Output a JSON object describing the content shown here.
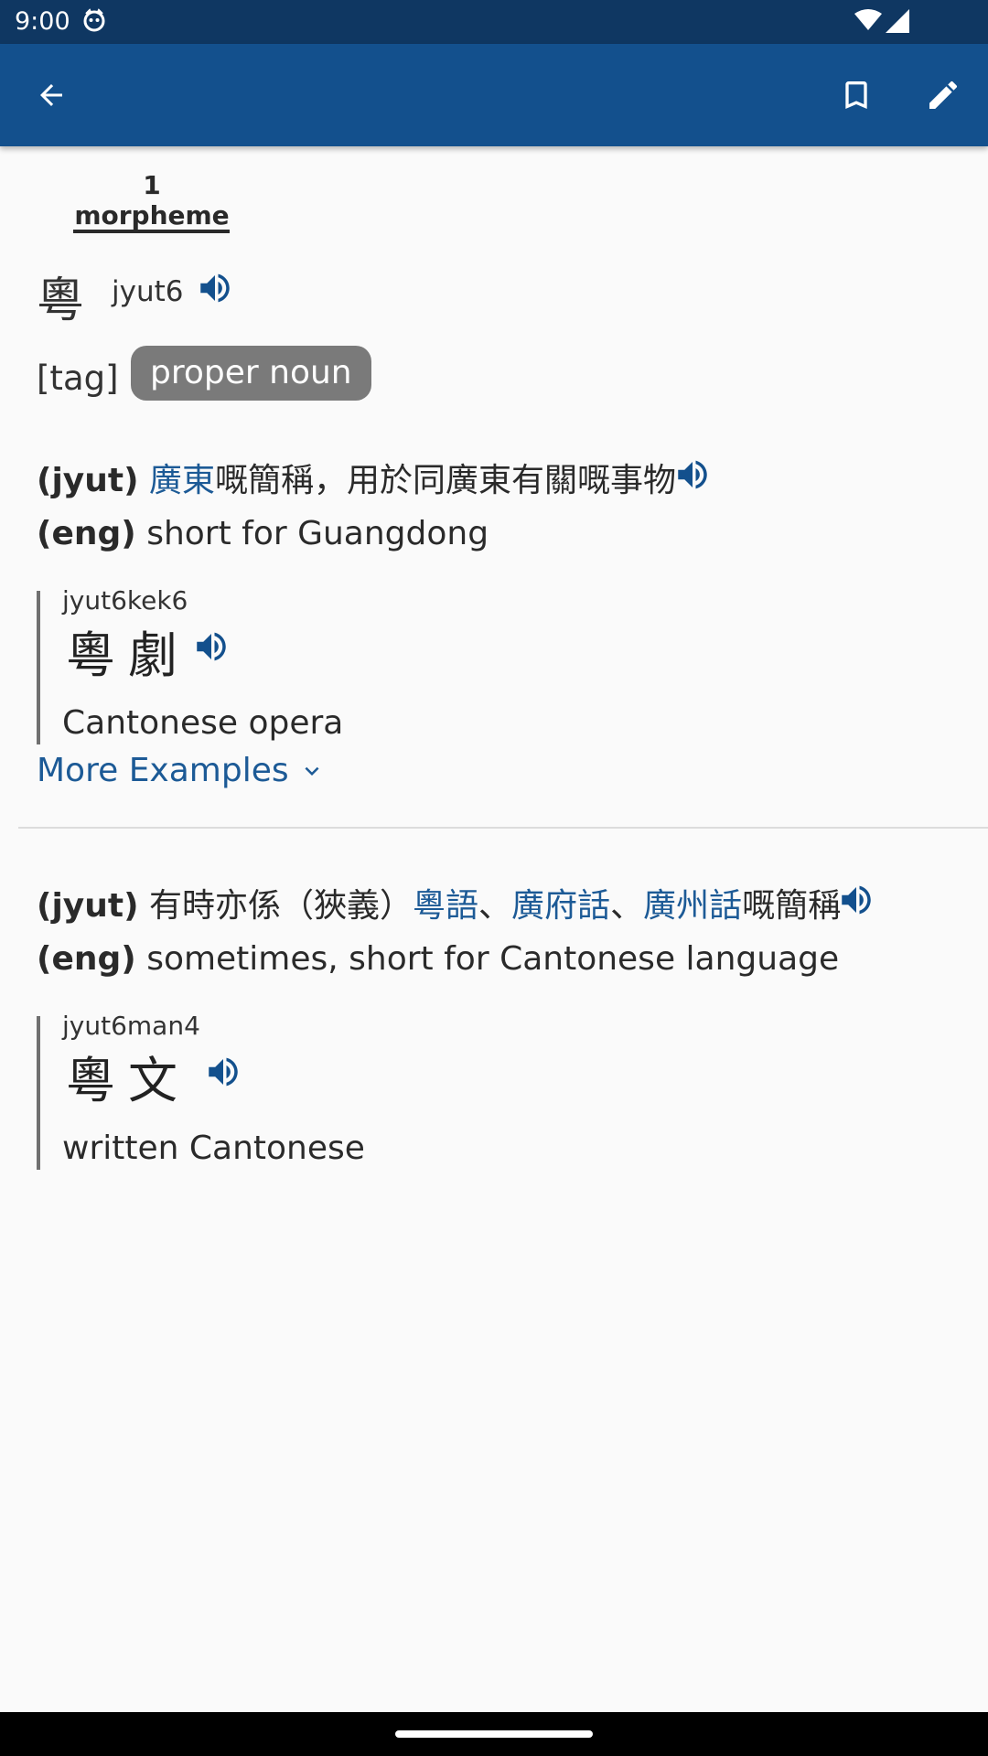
{
  "status_bar": {
    "time": "9:00"
  },
  "tabs": [
    {
      "label": "1 morpheme"
    }
  ],
  "entry": {
    "headword": "粵",
    "jyutping": "jyut6",
    "tag_label": "[tag]",
    "tag_value": "proper noun"
  },
  "definitions": [
    {
      "jyut_label": "(jyut)",
      "jyut_parts": [
        {
          "text": "廣東",
          "link": true
        },
        {
          "text": "嘅簡稱，用於同廣東有關嘅事物",
          "link": false
        }
      ],
      "eng_label": "(eng)",
      "eng_text": "short for Guangdong",
      "examples": [
        {
          "jyutping": "jyut6kek6",
          "word": "粵劇",
          "eng": "Cantonese opera"
        }
      ],
      "more_examples": "More Examples"
    },
    {
      "jyut_label": "(jyut)",
      "jyut_parts": [
        {
          "text": "有時亦係（狹義）",
          "link": false
        },
        {
          "text": "粵語",
          "link": true
        },
        {
          "text": "、",
          "link": false
        },
        {
          "text": "廣府話",
          "link": true
        },
        {
          "text": "、",
          "link": false
        },
        {
          "text": "廣州話",
          "link": true
        },
        {
          "text": "嘅簡稱",
          "link": false
        }
      ],
      "eng_label": "(eng)",
      "eng_text": "sometimes, short for Cantonese language",
      "examples": [
        {
          "jyutping": "jyut6man4",
          "word": "粵文",
          "eng": "written Cantonese"
        }
      ]
    }
  ],
  "icons": {
    "back": "arrow-back-icon",
    "bookmark": "bookmark-icon",
    "edit": "edit-pencil-icon",
    "speaker": "speaker-icon",
    "chevron": "chevron-down-icon"
  },
  "colors": {
    "status_bar": "#0f3762",
    "app_bar": "#13508d",
    "link": "#1c5a96",
    "tag_chip": "#7a7a7a"
  }
}
